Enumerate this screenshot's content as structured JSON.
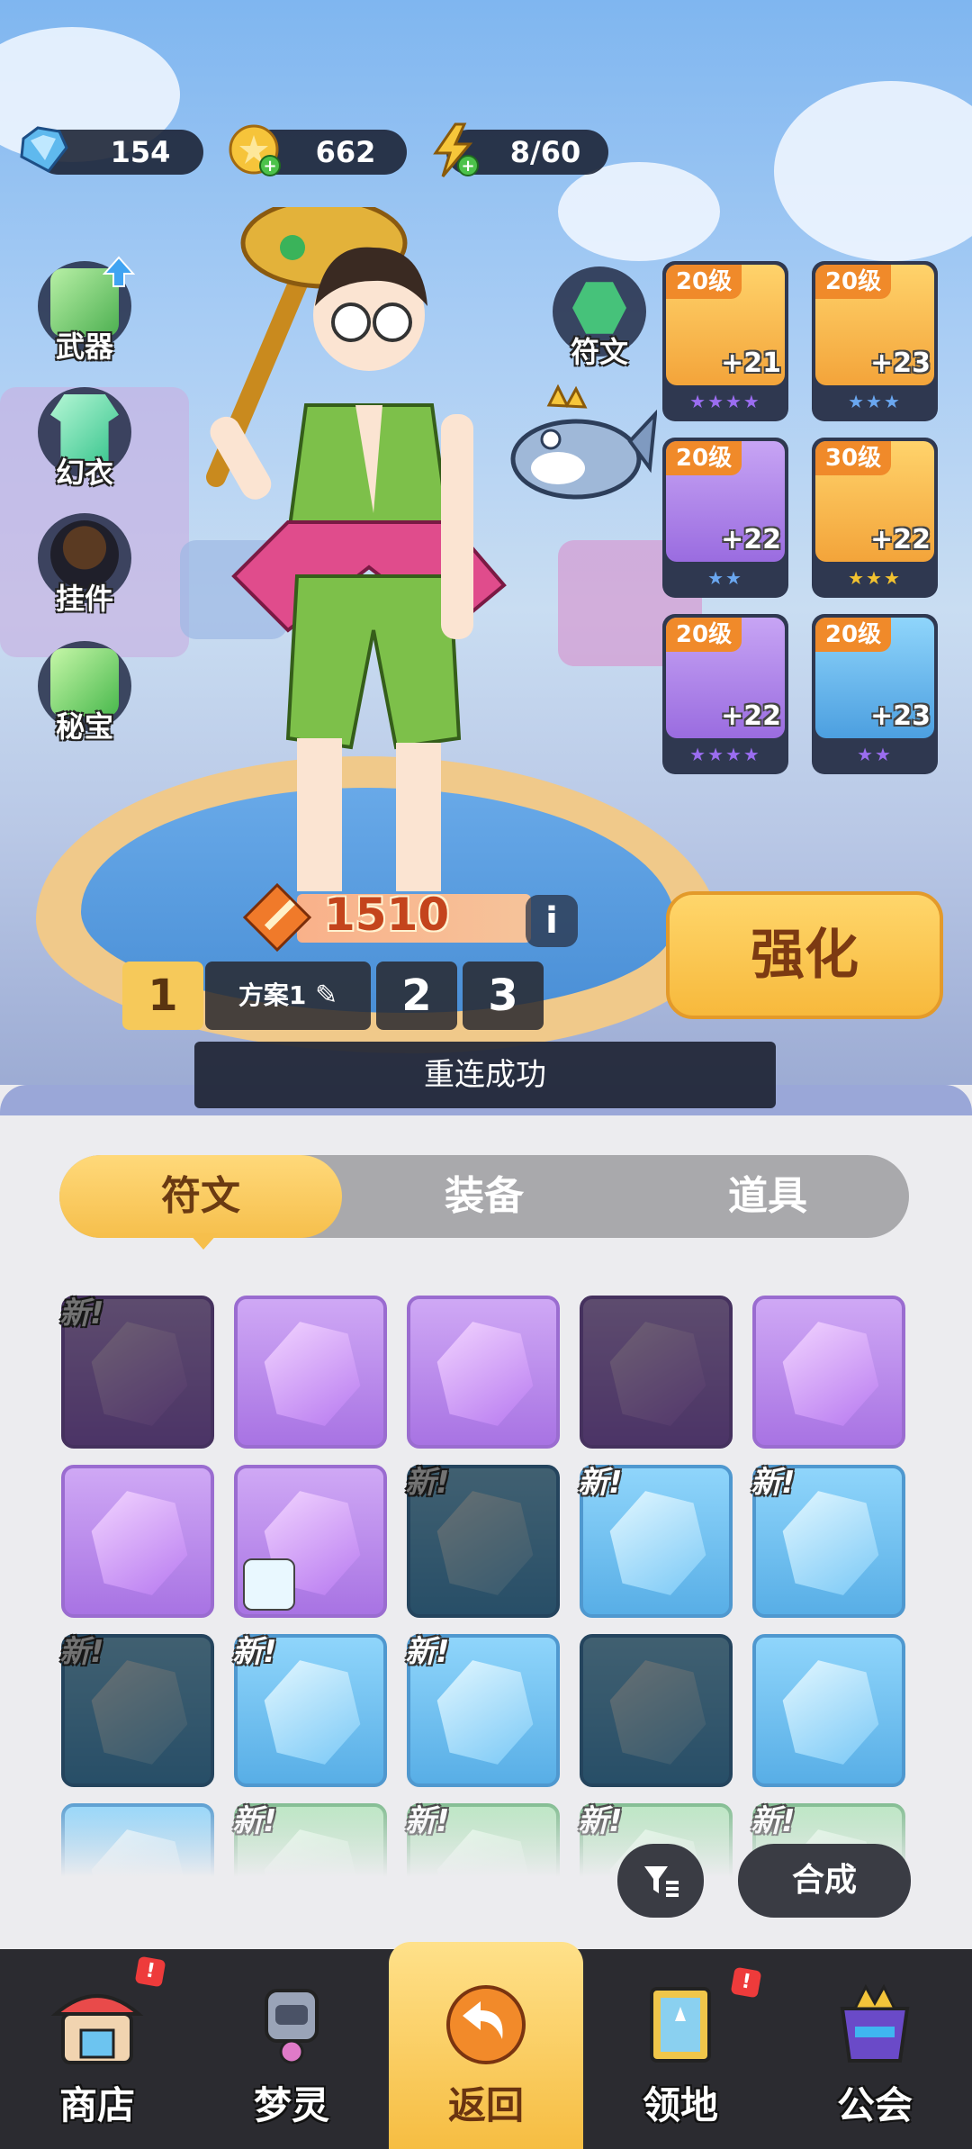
{
  "resources": {
    "diamonds": "154",
    "gold": "662",
    "energy": "8/60"
  },
  "left_menu": [
    {
      "label": "武器",
      "icon": "weapon-icon"
    },
    {
      "label": "幻衣",
      "icon": "outfit-icon"
    },
    {
      "label": "挂件",
      "icon": "pendant-icon"
    },
    {
      "label": "秘宝",
      "icon": "treasure-icon"
    }
  ],
  "rune_button": {
    "label": "符文"
  },
  "equipment": [
    {
      "level": "20级",
      "plus": "+21",
      "stars": "★★★★",
      "star_color": "#9b6df0"
    },
    {
      "level": "20级",
      "plus": "+23",
      "stars": "★★★",
      "star_color": "#6aa7f0"
    },
    {
      "level": "20级",
      "plus": "+22",
      "stars": "★★",
      "star_color": "#6aa7f0"
    },
    {
      "level": "30级",
      "plus": "+22",
      "stars": "★★★",
      "star_color": "#f2c230"
    },
    {
      "level": "20级",
      "plus": "+22",
      "stars": "★★★★",
      "star_color": "#9b6df0"
    },
    {
      "level": "20级",
      "plus": "+23",
      "stars": "★★",
      "star_color": "#9b6df0"
    }
  ],
  "power": {
    "value": "1510"
  },
  "plans": {
    "plan1_number": "1",
    "plan1_name": "方案1",
    "plan2": "2",
    "plan3": "3"
  },
  "enhance_label": "强化",
  "toast": "重连成功",
  "tabs": [
    {
      "label": "符文",
      "active": true
    },
    {
      "label": "装备",
      "active": false
    },
    {
      "label": "道具",
      "active": false
    }
  ],
  "new_tag": "新!",
  "rune_grid": [
    {
      "color": "purple",
      "dim": true,
      "new": true
    },
    {
      "color": "purple",
      "dim": false,
      "new": false
    },
    {
      "color": "purple",
      "dim": false,
      "new": false
    },
    {
      "color": "purple",
      "dim": true,
      "new": false
    },
    {
      "color": "purple",
      "dim": false,
      "new": false
    },
    {
      "color": "purple",
      "dim": false,
      "new": false
    },
    {
      "color": "purple",
      "dim": false,
      "new": false,
      "avatar": true
    },
    {
      "color": "blue",
      "dim": true,
      "new": true
    },
    {
      "color": "blue",
      "dim": false,
      "new": true
    },
    {
      "color": "blue",
      "dim": false,
      "new": true
    },
    {
      "color": "blue",
      "dim": true,
      "new": true
    },
    {
      "color": "blue",
      "dim": false,
      "new": true
    },
    {
      "color": "blue",
      "dim": false,
      "new": true
    },
    {
      "color": "blue",
      "dim": true,
      "new": false
    },
    {
      "color": "blue",
      "dim": false,
      "new": false
    },
    {
      "color": "blue",
      "dim": false,
      "new": false
    },
    {
      "color": "green",
      "dim": false,
      "new": true
    },
    {
      "color": "green",
      "dim": false,
      "new": true
    },
    {
      "color": "green",
      "dim": false,
      "new": true
    },
    {
      "color": "green",
      "dim": false,
      "new": true
    }
  ],
  "filter_icon": "filter-icon",
  "merge_label": "合成",
  "nav": [
    {
      "label": "商店",
      "icon": "shop-icon",
      "badge": "!"
    },
    {
      "label": "梦灵",
      "icon": "robot-icon",
      "badge": ""
    },
    {
      "label": "返回",
      "icon": "return-icon",
      "badge": "",
      "active": true
    },
    {
      "label": "领地",
      "icon": "territory-icon",
      "badge": "!"
    },
    {
      "label": "公会",
      "icon": "guild-icon",
      "badge": ""
    }
  ]
}
